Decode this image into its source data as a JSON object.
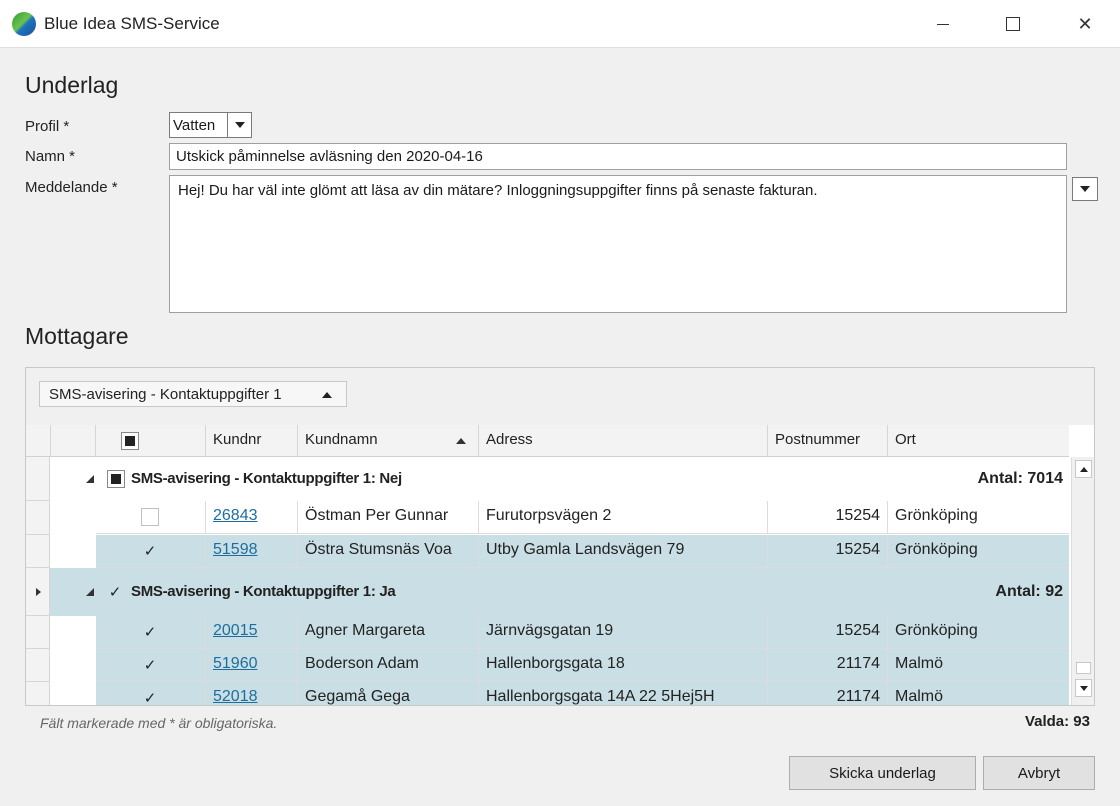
{
  "window": {
    "title": "Blue Idea SMS-Service"
  },
  "underlag": {
    "section_title": "Underlag",
    "profil_label": "Profil *",
    "profil_value": "Vatten",
    "namn_label": "Namn *",
    "namn_value": "Utskick påminnelse avläsning den 2020-04-16",
    "meddelande_label": "Meddelande *",
    "meddelande_value": "Hej! Du har väl inte glömt att läsa av din mätare? Inloggningsuppgifter finns på senaste fakturan."
  },
  "mottagare": {
    "section_title": "Mottagare",
    "groupby_chip": "SMS-avisering - Kontaktuppgifter 1",
    "columns": [
      "Kundnr",
      "Kundnamn",
      "Adress",
      "Postnummer",
      "Ort"
    ],
    "groups": [
      {
        "label": "SMS-avisering - Kontaktuppgifter 1: Nej",
        "count": "Antal: 7014",
        "rows": [
          {
            "kundnr": "26843",
            "kundnamn": "Östman Per Gunnar",
            "adress": "Furutorpsvägen 2",
            "postnummer": "15254",
            "ort": "Grönköping"
          },
          {
            "kundnr": "51598",
            "kundnamn": "Östra Stumsnäs Voa",
            "adress": "Utby Gamla Landsvägen 79",
            "postnummer": "15254",
            "ort": "Grönköping"
          }
        ]
      },
      {
        "label": "SMS-avisering - Kontaktuppgifter 1: Ja",
        "count": "Antal: 92",
        "rows": [
          {
            "kundnr": "20015",
            "kundnamn": "Agner Margareta",
            "adress": "Järnvägsgatan 19",
            "postnummer": "15254",
            "ort": "Grönköping"
          },
          {
            "kundnr": "51960",
            "kundnamn": "Boderson Adam",
            "adress": "Hallenborgsgata 18",
            "postnummer": "21174",
            "ort": "Malmö"
          },
          {
            "kundnr": "52018",
            "kundnamn": "Gegamå Gega",
            "adress": "Hallenborgsgata 14A 22 5Hej5H",
            "postnummer": "21174",
            "ort": "Malmö"
          }
        ]
      }
    ]
  },
  "footer": {
    "note": "Fält markerade med * är obligatoriska.",
    "selected_count": "Valda: 93",
    "send_button": "Skicka underlag",
    "cancel_button": "Avbryt"
  },
  "icons": {
    "app_logo": "blue-idea-logo-icon",
    "minimize": "minimize-icon",
    "maximize": "maximize-icon",
    "close": "close-icon"
  }
}
